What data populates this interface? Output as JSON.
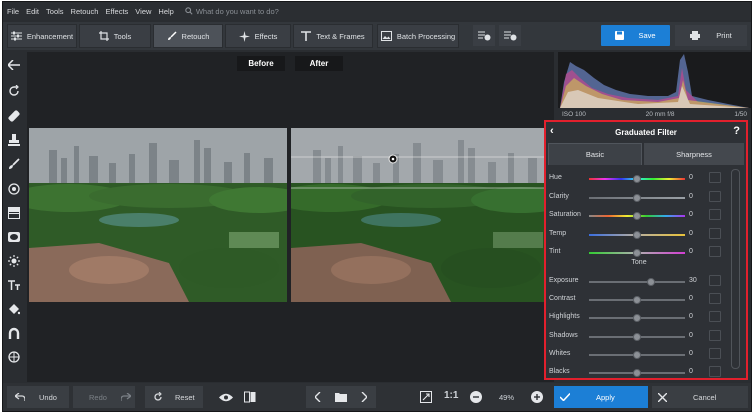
{
  "menu": [
    "File",
    "Edit",
    "Tools",
    "Retouch",
    "Effects",
    "View",
    "Help"
  ],
  "search": {
    "placeholder": "What do you want to do?"
  },
  "tabs": [
    {
      "label": "Enhancement",
      "icon": "sliders-icon"
    },
    {
      "label": "Tools",
      "icon": "crop-icon"
    },
    {
      "label": "Retouch",
      "icon": "brush-icon",
      "active": true
    },
    {
      "label": "Effects",
      "icon": "sparkle-icon"
    },
    {
      "label": "Text & Frames",
      "icon": "text-icon"
    },
    {
      "label": "Batch Processing",
      "icon": "batch-icon"
    }
  ],
  "toolbar": {
    "save_label": "Save",
    "print_label": "Print"
  },
  "compare": {
    "before_label": "Before",
    "after_label": "After"
  },
  "exif": {
    "iso": "ISO 100",
    "focal": "20 mm f/8",
    "shutter": "1/50"
  },
  "panel": {
    "title": "Graduated Filter",
    "help": "?",
    "tab_basic": "Basic",
    "tab_sharpness": "Sharpness",
    "tone_header": "Tone",
    "color_sliders": [
      {
        "label": "Hue",
        "value": "0",
        "level": 0.5
      },
      {
        "label": "Clarity",
        "value": "0",
        "level": 0.5
      },
      {
        "label": "Saturation",
        "value": "0",
        "level": 0.5
      },
      {
        "label": "Temp",
        "value": "0",
        "level": 0.5
      },
      {
        "label": "Tint",
        "value": "0",
        "level": 0.5
      }
    ],
    "tone_sliders": [
      {
        "label": "Exposure",
        "value": "30",
        "level": 0.65
      },
      {
        "label": "Contrast",
        "value": "0",
        "level": 0.5
      },
      {
        "label": "Highlights",
        "value": "0",
        "level": 0.5
      },
      {
        "label": "Shadows",
        "value": "0",
        "level": 0.5
      },
      {
        "label": "Whites",
        "value": "0",
        "level": 0.5
      },
      {
        "label": "Blacks",
        "value": "0",
        "level": 0.5
      }
    ]
  },
  "bottom": {
    "undo_label": "Undo",
    "redo_label": "Redo",
    "reset_label": "Reset",
    "zoom_ratio": "1:1",
    "zoom_percent": "49%",
    "apply_label": "Apply",
    "cancel_label": "Cancel"
  },
  "colors": {
    "accent": "#1c7fd6",
    "highlight_border": "#e2202d"
  }
}
